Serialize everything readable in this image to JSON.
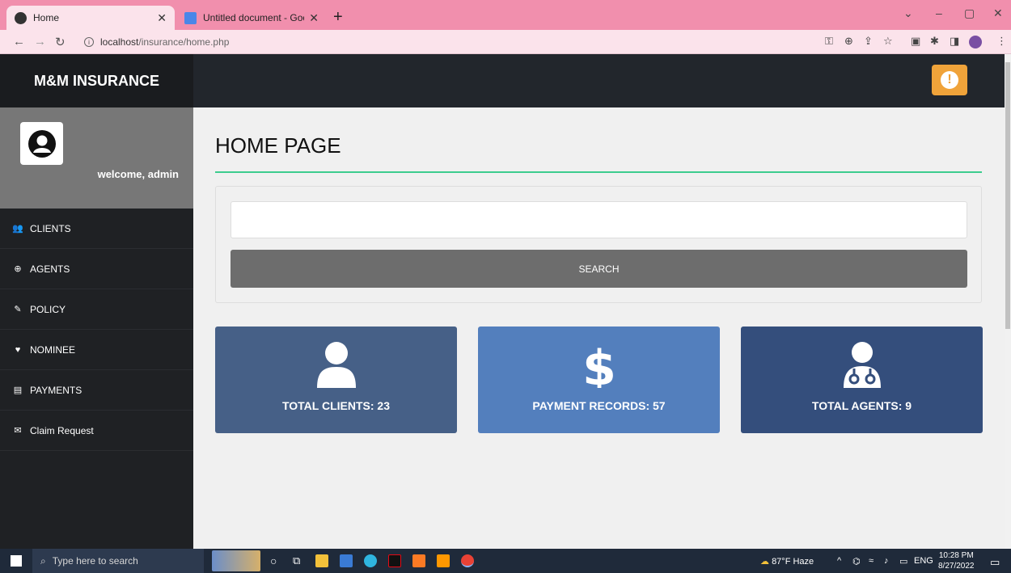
{
  "browser": {
    "tabs": [
      {
        "title": "Home",
        "active": true
      },
      {
        "title": "Untitled document - Google Doc",
        "active": false
      }
    ],
    "url_host": "localhost",
    "url_path": "/insurance/home.php",
    "tab_color": "#f18fad"
  },
  "app": {
    "brand": "M&M INSURANCE",
    "alert_icon": "exclamation-circle-icon",
    "accent_color": "#3ccc8e"
  },
  "sidebar": {
    "welcome": "welcome, admin",
    "items": [
      {
        "label": "CLIENTS",
        "icon": "users-icon"
      },
      {
        "label": "AGENTS",
        "icon": "support-icon"
      },
      {
        "label": "POLICY",
        "icon": "edit-icon"
      },
      {
        "label": "NOMINEE",
        "icon": "heart-icon"
      },
      {
        "label": "PAYMENTS",
        "icon": "credit-card-icon"
      },
      {
        "label": "Claim Request",
        "icon": "envelope-icon"
      }
    ]
  },
  "main": {
    "title": "HOME PAGE",
    "search": {
      "button_label": "SEARCH",
      "value": ""
    },
    "cards": [
      {
        "label": "TOTAL CLIENTS: 23",
        "icon": "user-icon",
        "color": "#466087"
      },
      {
        "label": "PAYMENT RECORDS: 57",
        "icon": "dollar-icon",
        "color": "#537fbd"
      },
      {
        "label": "TOTAL AGENTS: 9",
        "icon": "doctor-icon",
        "color": "#344e7c"
      }
    ]
  },
  "taskbar": {
    "search_placeholder": "Type here to search",
    "weather": "87°F Haze",
    "language": "ENG",
    "time": "10:28 PM",
    "date": "8/27/2022"
  }
}
